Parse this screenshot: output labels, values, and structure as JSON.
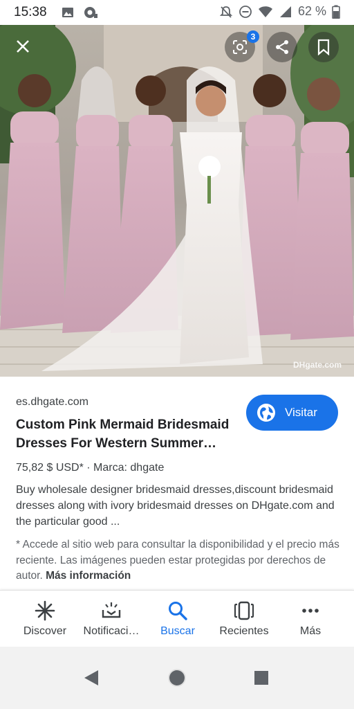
{
  "status_bar": {
    "time": "15:38",
    "battery_percent": "62 %"
  },
  "hero": {
    "watermark": "DHgate.com",
    "overlay": {
      "lens_badge_count": "3"
    }
  },
  "result": {
    "domain": "es.dhgate.com",
    "title": "Custom Pink Mermaid Bridesmaid Dresses For Western Summer…",
    "visit_label": "Visitar",
    "price_line": "75,82 $ USD* · Marca: dhgate",
    "description": "Buy wholesale designer bridesmaid dresses,discount bridesmaid dresses along with ivory bridesmaid dresses on DHgate.com and the particular good ...",
    "note_text": "* Accede al sitio web para consultar la disponibilidad y el precio más reciente. Las imágenes pueden estar protegidas por derechos de autor.",
    "note_link": "Más información"
  },
  "bottom_nav": {
    "items": [
      {
        "label": "Discover",
        "icon": "asterisk-icon"
      },
      {
        "label": "Notificaci…",
        "icon": "notifications-icon"
      },
      {
        "label": "Buscar",
        "icon": "search-icon",
        "active": true
      },
      {
        "label": "Recientes",
        "icon": "recents-icon"
      },
      {
        "label": "Más",
        "icon": "more-icon"
      }
    ]
  },
  "colors": {
    "accent": "#1a73e8",
    "dress_pink": "#d9aebf"
  }
}
